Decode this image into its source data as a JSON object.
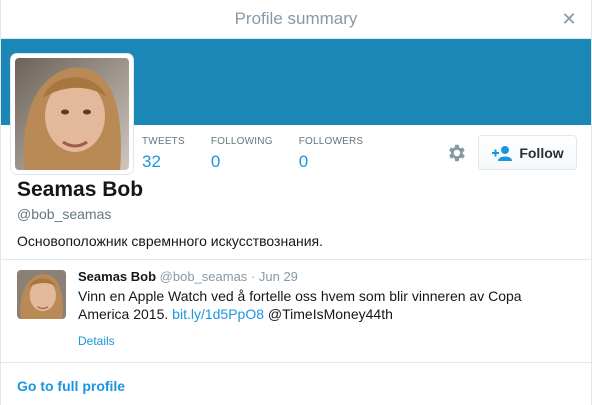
{
  "header": {
    "title": "Profile summary",
    "close_icon": "close-icon"
  },
  "colors": {
    "banner": "#1b87b7",
    "link": "#1b95e0"
  },
  "profile": {
    "name": "Seamas Bob",
    "handle": "@bob_seamas",
    "bio": "Основоположник свремнного искусствознания."
  },
  "stats": [
    {
      "label": "TWEETS",
      "value": "32"
    },
    {
      "label": "FOLLOWING",
      "value": "0"
    },
    {
      "label": "FOLLOWERS",
      "value": "0"
    }
  ],
  "actions": {
    "settings_icon": "gear-icon",
    "follow_label": "Follow",
    "follow_icon": "add-user-icon"
  },
  "tweet": {
    "name": "Seamas Bob",
    "handle": "@bob_seamas",
    "separator": " · ",
    "date": "Jun 29",
    "text_before": "Vinn en Apple Watch ved å fortelle oss hvem som blir vinneren av Copa America 2015. ",
    "link": "bit.ly/1d5PpO8",
    "text_after": " @TimeIsMoney44th",
    "details_label": "Details"
  },
  "footer": {
    "full_profile_label": "Go to full profile"
  }
}
